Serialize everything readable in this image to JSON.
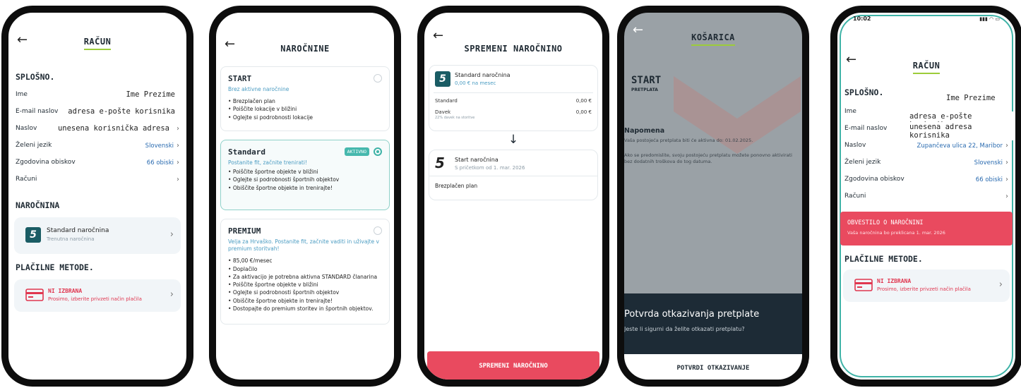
{
  "screen1": {
    "title": "RAČUN",
    "section_general": "SPLOŠNO.",
    "rows": [
      {
        "label": "Ime",
        "value": "Ime Prezime"
      },
      {
        "label": "E-mail naslov",
        "value": "adresa e-pošte korisnika"
      },
      {
        "label": "Naslov",
        "value": "unesena korisnička adresa"
      },
      {
        "label": "Želeni jezik",
        "value": "Slovenski"
      },
      {
        "label": "Zgodovina obiskov",
        "value": "66 obiski"
      },
      {
        "label": "Računi",
        "value": ""
      }
    ],
    "section_subscription": "NAROČNINA",
    "subscription_title": "Standard naročnina",
    "subscription_sub": "Trenutna naročnina",
    "section_payment": "PLAČILNE METODE.",
    "payment_title": "NI IZBRANA",
    "payment_sub": "Prosimo, izberite privzeti način plačila"
  },
  "screen2": {
    "title": "NAROČNINE",
    "start": {
      "name": "START",
      "lead": "Brez aktivne naročnine",
      "items": [
        "Brezplačen plan",
        "Poiščite lokacije v bližini",
        "Oglejte si podrobnosti lokacije"
      ]
    },
    "standard": {
      "name": "Standard",
      "badge": "AKTIVNO",
      "lead": "Postanite fit, začnite trenirati!",
      "items": [
        "Poiščite športne objekte v bližini",
        "Oglejte si podrobnosti športnih objektov",
        "Obiščite športne objekte in trenirajte!"
      ]
    },
    "premium": {
      "name": "PREMIUM",
      "lead": "Velja za Hrvaško. Postanite fit, začnite vaditi in uživajte v premium storitvah!",
      "items": [
        "85,00 €/mesec",
        "Doplačilo",
        "Za aktivacijo je potrebna aktivna STANDARD članarina",
        "Poiščite športne objekte v bližini",
        "Oglejte si podrobnosti športnih objektov",
        "Obiščite športne objekte in trenirajte!",
        "Dostopajte do premium storitev in športnih objektov."
      ]
    }
  },
  "screen3": {
    "title": "SPREMENI NAROČNINO",
    "from_title": "Standard naročnina",
    "from_sub": "0,00 € na mesec",
    "line1_label": "Standard",
    "line1_value": "0,00 €",
    "line2_label": "Davek",
    "line2_sub": "22% davek na storitve",
    "line2_value": "0,00 €",
    "arrow": "↓",
    "to_title": "Start naročnina",
    "to_sub": "S pričetkom od 1. mar. 2026",
    "to_plan": "Brezplačen plan",
    "button": "SPREMENI NAROČNINO"
  },
  "screen4": {
    "title": "KOŠARICA",
    "plan": "START",
    "plan_sub": "PRETPLATA",
    "note_title": "Napomena",
    "note1": "Vaša postojeća pretplata biti će aktivna do: 01.02.2025.",
    "note2": "Ako se predomislite, svoju postojeću pretplatu možete ponovno aktivirati bez dodatnih troškova do tog datuma.",
    "sheet_title": "Potvrda otkazivanja pretplate",
    "sheet_q": "Jeste li sigurni da želite otkazati pretplatu?",
    "button": "POTVRDI OTKAZIVANJE"
  },
  "screen5": {
    "status": "10:02",
    "title": "RAČUN",
    "section_general": "SPLOŠNO.",
    "rows": [
      {
        "label": "Ime",
        "value": "Ime Prezime"
      },
      {
        "label": "E-mail naslov",
        "value": "adresa e-pošte korisnika"
      },
      {
        "label": "Naslov",
        "value": "Zupančeva ulica 22, Maribor"
      },
      {
        "label": "Želeni jezik",
        "value": "Slovenski"
      },
      {
        "label": "Zgodovina obiskov",
        "value": "66 obiski"
      },
      {
        "label": "Računi",
        "value": ""
      }
    ],
    "overlay_address": "unesena adresa korisnika",
    "notice_title": "OBVESTILO O NAROČNINI",
    "notice_sub": "Vaša naročnina bo preklicana 1. mar. 2026",
    "section_payment": "PLAČILNE METODE.",
    "payment_title": "NI IZBRANA",
    "payment_sub": "Prosimo, izberite privzeti način plačila"
  },
  "colors": {
    "accent_green": "#9ccc3a",
    "teal": "#46b8ad",
    "red": "#e94a5f",
    "dark": "#0d0d0d"
  }
}
